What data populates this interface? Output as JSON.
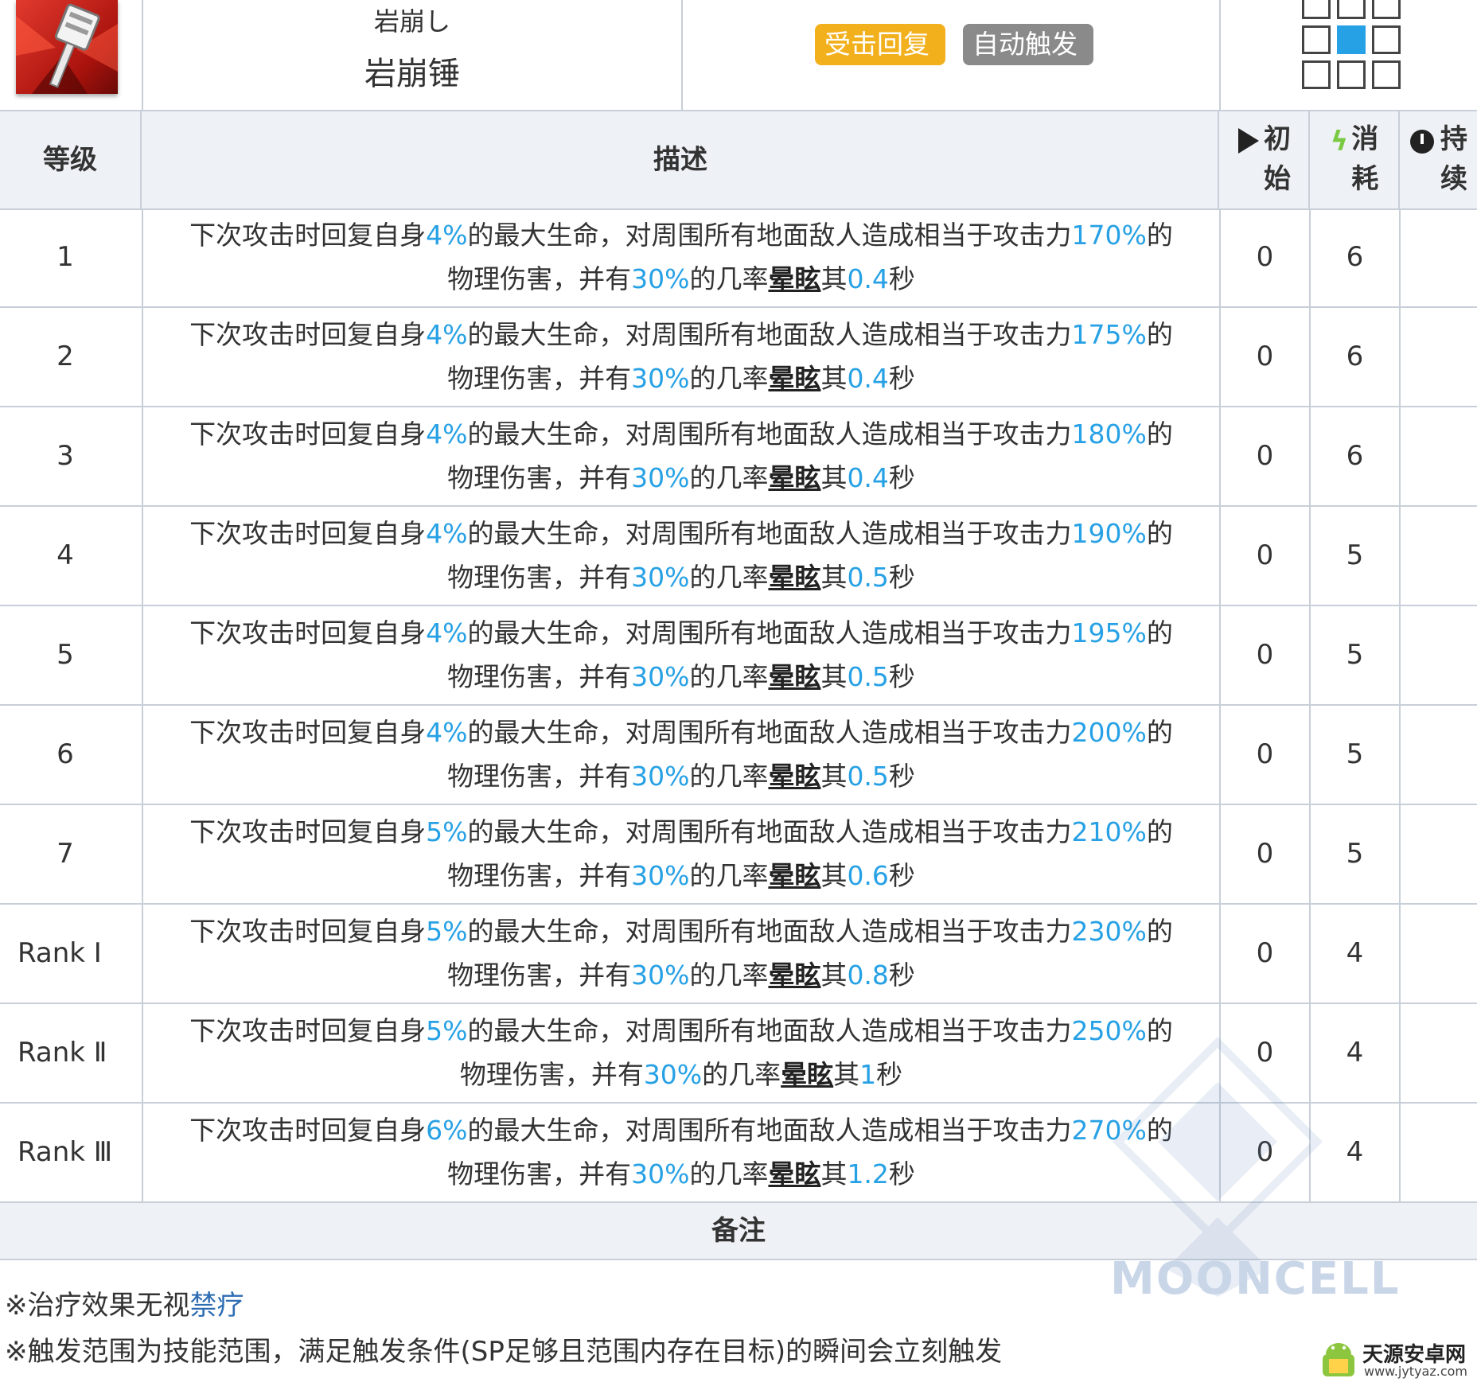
{
  "skill": {
    "icon": "hammer-icon",
    "name_jp": "岩崩し",
    "name_cn": "岩崩锤",
    "tags": [
      "受击回复",
      "自动触发"
    ]
  },
  "table_header": {
    "level": "等级",
    "description": "描述",
    "initial": "初始",
    "cost": "消耗",
    "duration": "持续"
  },
  "desc_template": {
    "p1": "下次攻击时回复自身",
    "p2": "的最大生命，对周围所有地面敌人造成相当于攻击力",
    "p3": "的",
    "p4": "物理伤害，并有",
    "p5": "的几率",
    "keyword": "晕眩",
    "p6": "其",
    "p7": "秒"
  },
  "rows": [
    {
      "level": "1",
      "heal": "4%",
      "atk": "170%",
      "chance": "30%",
      "stun": "0.4",
      "initial": "0",
      "cost": "6"
    },
    {
      "level": "2",
      "heal": "4%",
      "atk": "175%",
      "chance": "30%",
      "stun": "0.4",
      "initial": "0",
      "cost": "6"
    },
    {
      "level": "3",
      "heal": "4%",
      "atk": "180%",
      "chance": "30%",
      "stun": "0.4",
      "initial": "0",
      "cost": "6"
    },
    {
      "level": "4",
      "heal": "4%",
      "atk": "190%",
      "chance": "30%",
      "stun": "0.5",
      "initial": "0",
      "cost": "5"
    },
    {
      "level": "5",
      "heal": "4%",
      "atk": "195%",
      "chance": "30%",
      "stun": "0.5",
      "initial": "0",
      "cost": "5"
    },
    {
      "level": "6",
      "heal": "4%",
      "atk": "200%",
      "chance": "30%",
      "stun": "0.5",
      "initial": "0",
      "cost": "5"
    },
    {
      "level": "7",
      "heal": "5%",
      "atk": "210%",
      "chance": "30%",
      "stun": "0.6",
      "initial": "0",
      "cost": "5"
    },
    {
      "level": "Rank Ⅰ",
      "heal": "5%",
      "atk": "230%",
      "chance": "30%",
      "stun": "0.8",
      "initial": "0",
      "cost": "4"
    },
    {
      "level": "Rank Ⅱ",
      "heal": "5%",
      "atk": "250%",
      "chance": "30%",
      "stun": "1",
      "initial": "0",
      "cost": "4"
    },
    {
      "level": "Rank Ⅲ",
      "heal": "6%",
      "atk": "270%",
      "chance": "30%",
      "stun": "1.2",
      "initial": "0",
      "cost": "4"
    }
  ],
  "notes": {
    "title": "备注",
    "note1_prefix": "※治疗效果无视",
    "note1_link": "禁疗",
    "note2": "※触发范围为技能范围，满足触发条件(SP足够且范围内存在目标)的瞬间会立刻触发"
  },
  "watermark": "MOONCELL",
  "site_badge": {
    "name": "天源安卓网",
    "url": "www.jytyaz.com"
  },
  "colors": {
    "value": "#27a1e5",
    "tag_yellow": "#f2b01c",
    "tag_gray": "#8a8a8a",
    "range_self": "#27a1e5",
    "header_bg": "#eef1f5"
  }
}
